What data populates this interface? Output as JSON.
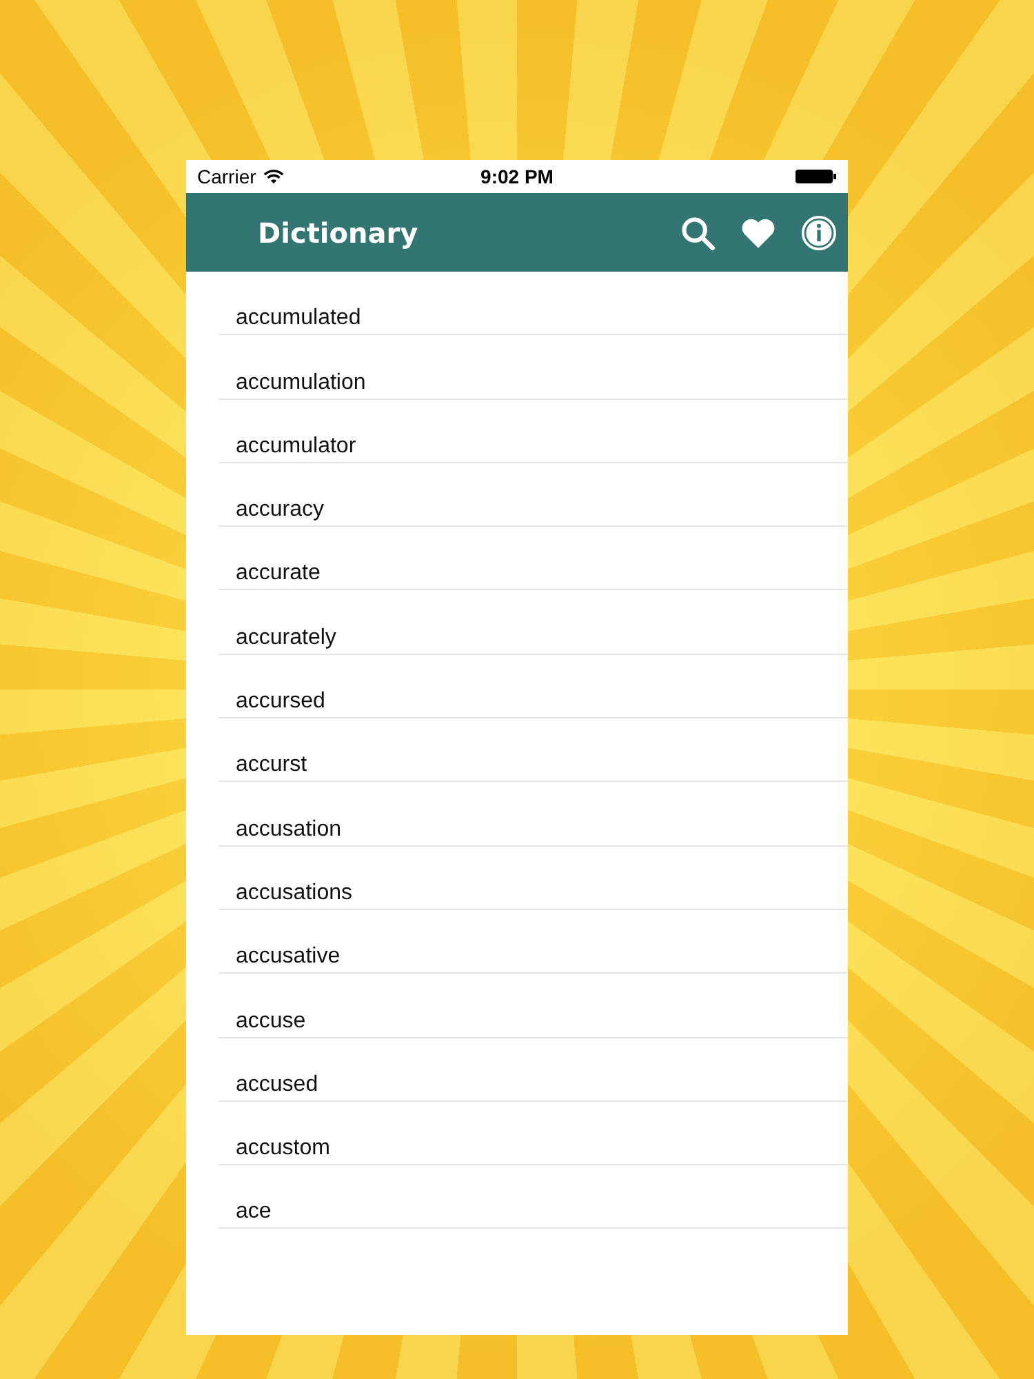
{
  "status_bar": {
    "carrier": "Carrier",
    "time": "9:02 PM"
  },
  "nav_bar": {
    "title": "Dictionary"
  },
  "words": [
    "accumulated",
    "accumulation",
    "accumulator",
    "accuracy",
    "accurate",
    "accurately",
    "accursed",
    "accurst",
    "accusation",
    "accusations",
    "accusative",
    "accuse",
    "accused",
    "accustom",
    "ace"
  ]
}
